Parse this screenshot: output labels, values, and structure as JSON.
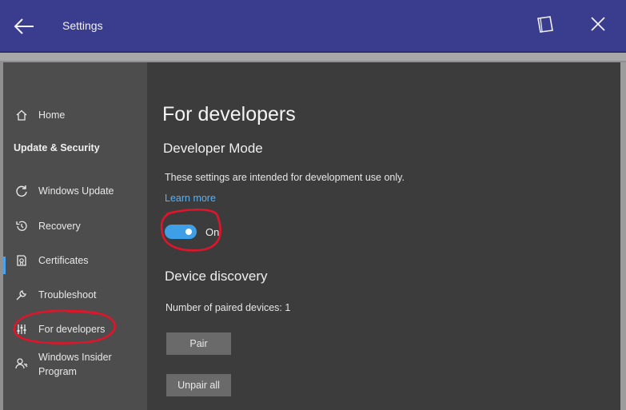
{
  "window": {
    "title": "Settings",
    "icons": {
      "back": "back-arrow-icon",
      "frame": "window-frame-icon",
      "close": "close-icon"
    }
  },
  "sidebar": {
    "home": {
      "label": "Home",
      "icon": "home-icon"
    },
    "section_title": "Update & Security",
    "items": [
      {
        "label": "Windows Update",
        "icon": "sync-icon"
      },
      {
        "label": "Recovery",
        "icon": "history-icon"
      },
      {
        "label": "Certificates",
        "icon": "certificate-icon"
      },
      {
        "label": "Troubleshoot",
        "icon": "wrench-icon"
      },
      {
        "label": "For developers",
        "icon": "developer-tools-icon",
        "active": true
      },
      {
        "label": "Windows Insider Program",
        "icon": "insider-icon"
      }
    ]
  },
  "main": {
    "page_title": "For developers",
    "developer_mode": {
      "heading": "Developer Mode",
      "description": "These settings are intended for development use only.",
      "learn_more": "Learn more",
      "toggle_state": "On",
      "toggle_on": true
    },
    "device_discovery": {
      "heading": "Device discovery",
      "paired_devices": "Number of paired devices: 1",
      "pair_button": "Pair",
      "unpair_button": "Unpair all"
    }
  },
  "colors": {
    "titlebar": "#3a3d8e",
    "sidebar_bg": "#4d4d4d",
    "content_bg": "#3c3c3c",
    "accent": "#3f9fe6",
    "link": "#5ab1f2",
    "annotation": "#e0142a"
  }
}
